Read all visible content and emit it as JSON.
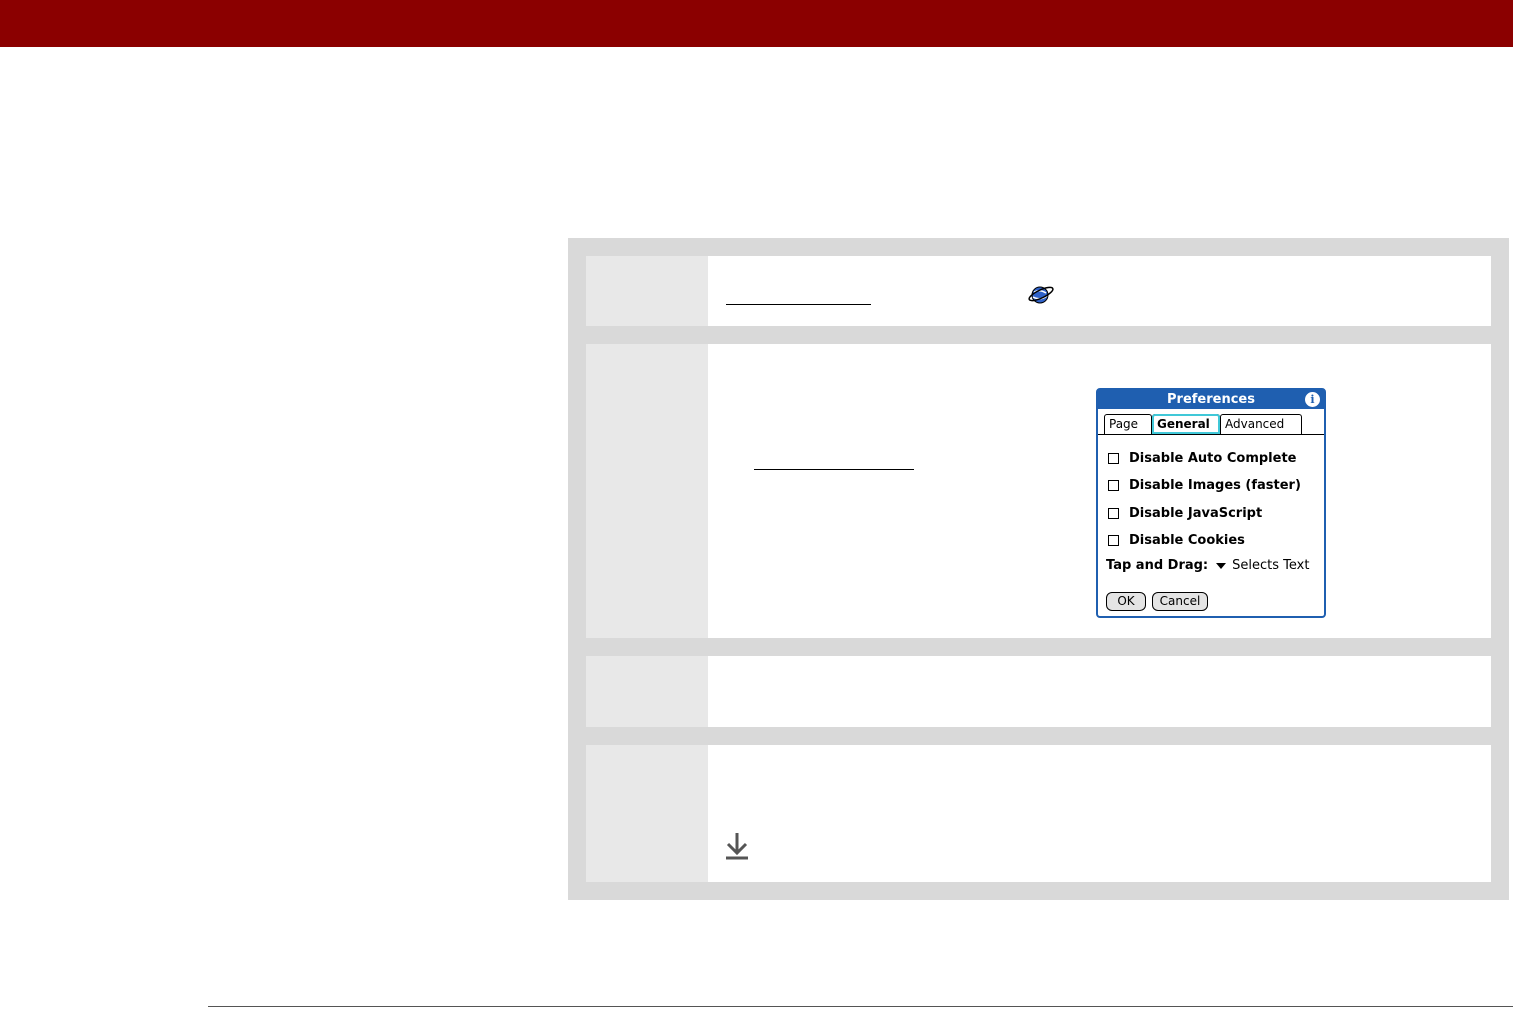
{
  "dialog": {
    "title": "Preferences",
    "info_icon": "info-icon",
    "tabs": [
      {
        "label": "Page",
        "selected": false
      },
      {
        "label": "General",
        "selected": true
      },
      {
        "label": "Advanced",
        "selected": false
      }
    ],
    "options": [
      {
        "label": "Disable Auto Complete",
        "checked": false
      },
      {
        "label": "Disable Images (faster)",
        "checked": false
      },
      {
        "label": "Disable JavaScript",
        "checked": false
      },
      {
        "label": "Disable Cookies",
        "checked": false
      }
    ],
    "tap_and_drag_label": "Tap and Drag:",
    "tap_and_drag_value": "Selects Text",
    "ok_label": "OK",
    "cancel_label": "Cancel",
    "accent_color": "#1f5fb0"
  },
  "colors": {
    "header_bar": "#8b0000",
    "step_frame": "#d9d9d9"
  },
  "icons": {
    "web_browser": "web-browser-icon",
    "download": "download-arrow-icon"
  }
}
